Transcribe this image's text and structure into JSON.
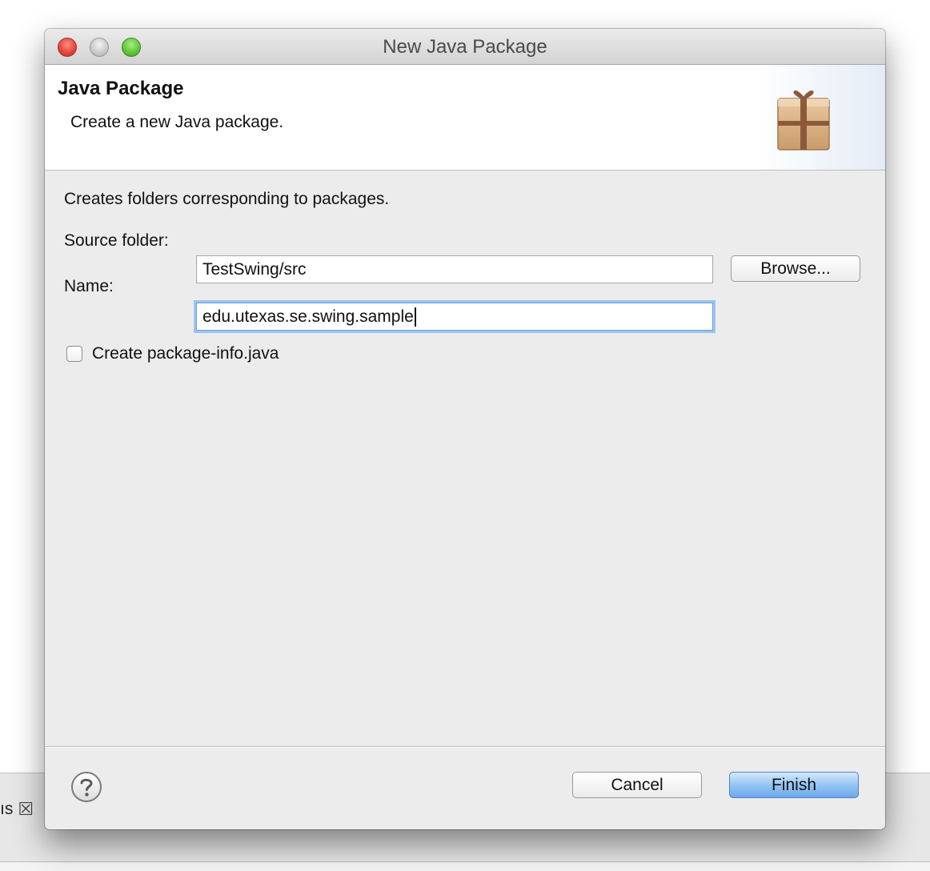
{
  "window": {
    "title": "New Java Package"
  },
  "header": {
    "title": "Java Package",
    "subtitle": "Create a new Java package."
  },
  "content": {
    "description": "Creates folders corresponding to packages.",
    "source_folder": {
      "label": "Source folder:",
      "value": "TestSwing/src",
      "browse_label": "Browse..."
    },
    "name": {
      "label": "Name:",
      "value": "edu.utexas.se.swing.sample"
    },
    "package_info": {
      "label": "Create package-info.java",
      "checked": false
    }
  },
  "footer": {
    "cancel_label": "Cancel",
    "finish_label": "Finish"
  },
  "background": {
    "tab_fragment": "ıs"
  },
  "colors": {
    "accent": "#6aa1df",
    "default_button": "#90c2f4",
    "close_light": "#e0443a",
    "zoom_light": "#5ec43a"
  }
}
